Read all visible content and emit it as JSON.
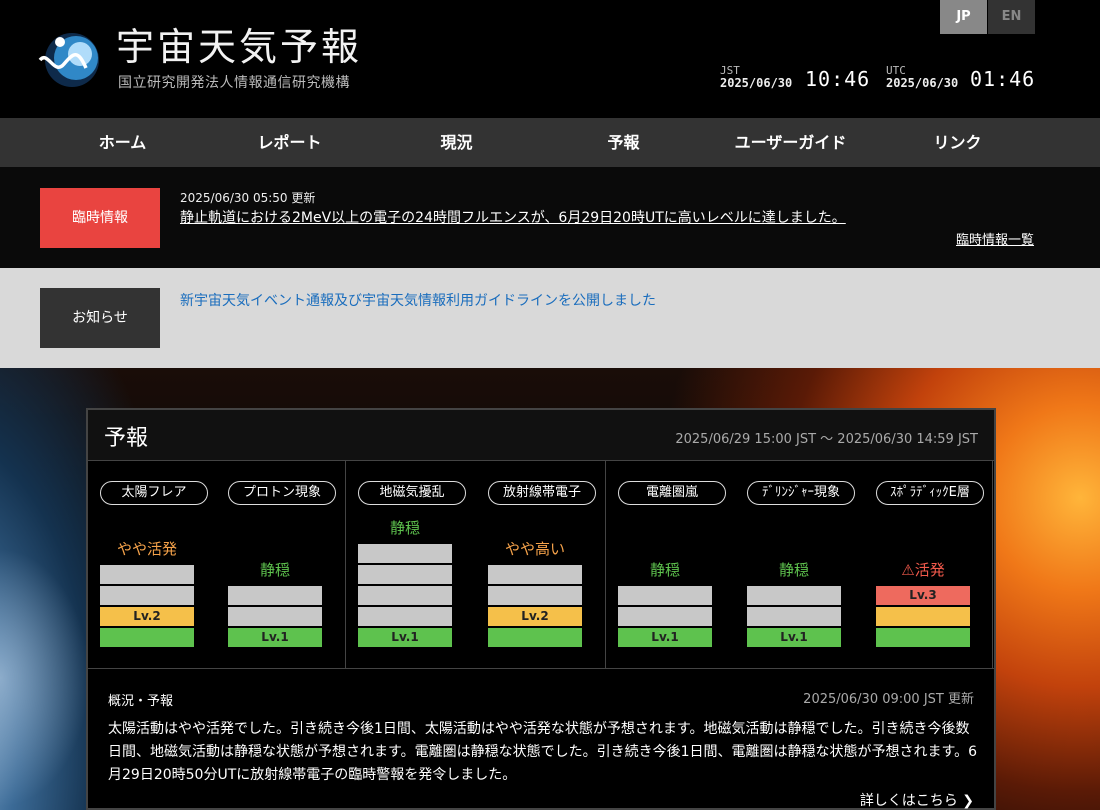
{
  "header": {
    "title": "宇宙天気予報",
    "subtitle": "国立研究開発法人情報通信研究機構",
    "lang": [
      "JP",
      "EN"
    ],
    "jst_label": "JST",
    "jst_date": "2025/06/30",
    "jst_time": "10:46",
    "utc_label": "UTC",
    "utc_date": "2025/06/30",
    "utc_time": "01:46"
  },
  "nav": [
    "ホーム",
    "レポート",
    "現況",
    "予報",
    "ユーザーガイド",
    "リンク"
  ],
  "alert": {
    "badge": "臨時情報",
    "date": "2025/06/30 05:50 更新",
    "text": "静止軌道における2MeV以上の電子の24時間フルエンスが、6月29日20時UTに高いレベルに達しました。",
    "list_link": "臨時情報一覧"
  },
  "notice": {
    "badge": "お知らせ",
    "text": "新宇宙天気イベント通報及び宇宙天気情報利用ガイドラインを公開しました"
  },
  "forecast": {
    "title": "予報",
    "period": "2025/06/29 15:00 JST 〜 2025/06/30 14:59 JST",
    "items": [
      {
        "label": "太陽フレア",
        "status": "やや活発",
        "level": 2,
        "max": 4,
        "color": "#f5a24a"
      },
      {
        "label": "プロトン現象",
        "status": "静穏",
        "level": 1,
        "max": 3,
        "color": "#5ec24e"
      },
      {
        "label": "地磁気擾乱",
        "status": "静穏",
        "level": 1,
        "max": 5,
        "color": "#5ec24e"
      },
      {
        "label": "放射線帯電子",
        "status": "やや高い",
        "level": 2,
        "max": 4,
        "color": "#f5a24a"
      },
      {
        "label": "電離圏嵐",
        "status": "静穏",
        "level": 1,
        "max": 3,
        "color": "#5ec24e"
      },
      {
        "label": "ﾃﾞﾘﾝｼﾞｬｰ現象",
        "status": "静穏",
        "level": 1,
        "max": 3,
        "color": "#5ec24e"
      },
      {
        "label": "ｽﾎﾟﾗﾃﾞｨｯｸE層",
        "status": "活発",
        "level": 3,
        "max": 3,
        "color": "#f35a4c",
        "warn": true
      }
    ],
    "level_prefix": "Lv.",
    "level_colors": {
      "1": "#5ec24e",
      "2": "#f5c04a",
      "3": "#ee6a5e",
      "empty": "#c8c8c8"
    },
    "warn_icon": "warning-triangle-icon"
  },
  "summary": {
    "heading": "概況・予報",
    "updated": "2025/06/30 09:00 JST 更新",
    "text": "太陽活動はやや活発でした。引き続き今後1日間、太陽活動はやや活発な状態が予想されます。地磁気活動は静穏でした。引き続き今後数日間、地磁気活動は静穏な状態が予想されます。電離圏は静穏な状態でした。引き続き今後1日間、電離圏は静穏な状態が予想されます。6月29日20時50分UTに放射線帯電子の臨時警報を発令しました。",
    "more": "詳しくはこちら"
  }
}
